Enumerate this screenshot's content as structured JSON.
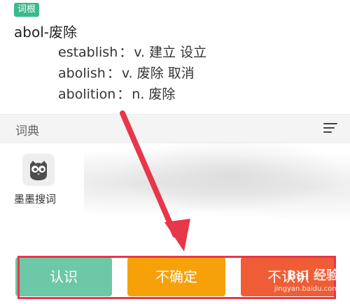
{
  "root_section": {
    "tag": "词根",
    "word": "abol-废除",
    "derivatives": [
      {
        "word": "establish",
        "colon": "：",
        "meaning": "v. 建立 设立"
      },
      {
        "word": "abolish",
        "colon": "：",
        "meaning": "v. 废除 取消"
      },
      {
        "word": "abolition",
        "colon": "：",
        "meaning": "n. 废除"
      }
    ]
  },
  "dictionary": {
    "title": "词典",
    "menu_icon": "menu-lines-icon",
    "apps": [
      {
        "label": "墨墨搜词",
        "icon": "owl-icon"
      }
    ]
  },
  "buttons": {
    "know": "认识",
    "unsure": "不确定",
    "unknown": "不认识"
  },
  "colors": {
    "tag_green": "#3bb98a",
    "know": "#6cc8a6",
    "unsure": "#f7a10a",
    "unknown": "#ee5d35",
    "annotation_red": "#e8374a"
  },
  "watermark": {
    "logo": "Bai 经验",
    "url": "jingyan.baidu.com"
  }
}
